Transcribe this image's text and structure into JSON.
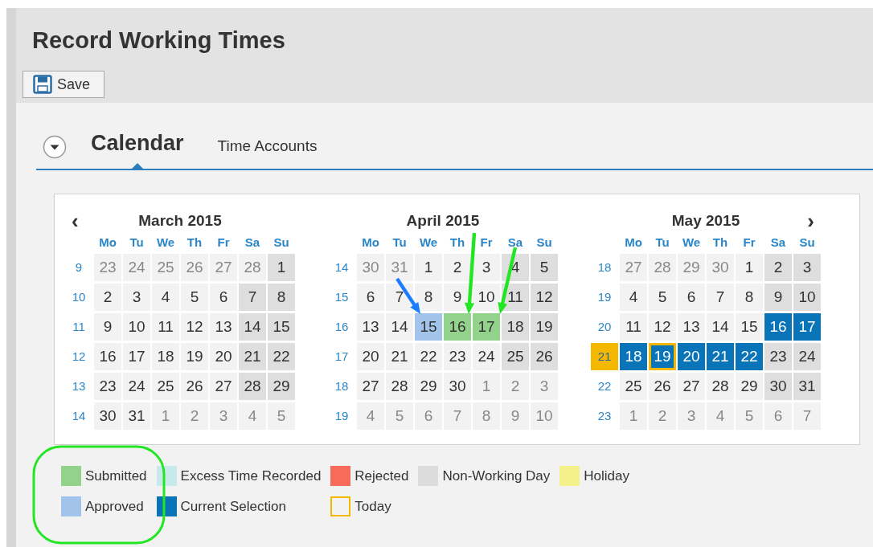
{
  "page": {
    "title": "Record Working Times"
  },
  "toolbar": {
    "save_button": "Save"
  },
  "tabs": [
    {
      "label": "Calendar",
      "selected": true
    },
    {
      "label": "Time Accounts",
      "selected": false
    }
  ],
  "calendar": {
    "prev": "‹",
    "next": "›",
    "months": [
      {
        "title": "March 2015",
        "weekdays": [
          "Mo",
          "Tu",
          "We",
          "Th",
          "Fr",
          "Sa",
          "Su"
        ],
        "weeks": [
          {
            "week": "9",
            "current": false,
            "days": [
              {
                "day": "23",
                "kind": "other",
                "today": false
              },
              {
                "day": "24",
                "kind": "other",
                "today": false
              },
              {
                "day": "25",
                "kind": "other",
                "today": false
              },
              {
                "day": "26",
                "kind": "other",
                "today": false
              },
              {
                "day": "27",
                "kind": "other",
                "today": false
              },
              {
                "day": "28",
                "kind": "other",
                "today": false
              },
              {
                "day": "1",
                "kind": "off",
                "today": false
              }
            ]
          },
          {
            "week": "10",
            "current": false,
            "days": [
              {
                "day": "2",
                "kind": "work",
                "today": false
              },
              {
                "day": "3",
                "kind": "work",
                "today": false
              },
              {
                "day": "4",
                "kind": "work",
                "today": false
              },
              {
                "day": "5",
                "kind": "work",
                "today": false
              },
              {
                "day": "6",
                "kind": "work",
                "today": false
              },
              {
                "day": "7",
                "kind": "off",
                "today": false
              },
              {
                "day": "8",
                "kind": "off",
                "today": false
              }
            ]
          },
          {
            "week": "11",
            "current": false,
            "days": [
              {
                "day": "9",
                "kind": "work",
                "today": false
              },
              {
                "day": "10",
                "kind": "work",
                "today": false
              },
              {
                "day": "11",
                "kind": "work",
                "today": false
              },
              {
                "day": "12",
                "kind": "work",
                "today": false
              },
              {
                "day": "13",
                "kind": "work",
                "today": false
              },
              {
                "day": "14",
                "kind": "off",
                "today": false
              },
              {
                "day": "15",
                "kind": "off",
                "today": false
              }
            ]
          },
          {
            "week": "12",
            "current": false,
            "days": [
              {
                "day": "16",
                "kind": "work",
                "today": false
              },
              {
                "day": "17",
                "kind": "work",
                "today": false
              },
              {
                "day": "18",
                "kind": "work",
                "today": false
              },
              {
                "day": "19",
                "kind": "work",
                "today": false
              },
              {
                "day": "20",
                "kind": "work",
                "today": false
              },
              {
                "day": "21",
                "kind": "off",
                "today": false
              },
              {
                "day": "22",
                "kind": "off",
                "today": false
              }
            ]
          },
          {
            "week": "13",
            "current": false,
            "days": [
              {
                "day": "23",
                "kind": "work",
                "today": false
              },
              {
                "day": "24",
                "kind": "work",
                "today": false
              },
              {
                "day": "25",
                "kind": "work",
                "today": false
              },
              {
                "day": "26",
                "kind": "work",
                "today": false
              },
              {
                "day": "27",
                "kind": "work",
                "today": false
              },
              {
                "day": "28",
                "kind": "off",
                "today": false
              },
              {
                "day": "29",
                "kind": "off",
                "today": false
              }
            ]
          },
          {
            "week": "14",
            "current": false,
            "days": [
              {
                "day": "30",
                "kind": "work",
                "today": false
              },
              {
                "day": "31",
                "kind": "work",
                "today": false
              },
              {
                "day": "1",
                "kind": "other",
                "today": false
              },
              {
                "day": "2",
                "kind": "other",
                "today": false
              },
              {
                "day": "3",
                "kind": "other",
                "today": false
              },
              {
                "day": "4",
                "kind": "other",
                "today": false
              },
              {
                "day": "5",
                "kind": "other",
                "today": false
              }
            ]
          }
        ]
      },
      {
        "title": "April 2015",
        "weekdays": [
          "Mo",
          "Tu",
          "We",
          "Th",
          "Fr",
          "Sa",
          "Su"
        ],
        "weeks": [
          {
            "week": "14",
            "current": false,
            "days": [
              {
                "day": "30",
                "kind": "other",
                "today": false
              },
              {
                "day": "31",
                "kind": "other",
                "today": false
              },
              {
                "day": "1",
                "kind": "work",
                "today": false
              },
              {
                "day": "2",
                "kind": "work",
                "today": false
              },
              {
                "day": "3",
                "kind": "work",
                "today": false
              },
              {
                "day": "4",
                "kind": "off",
                "today": false
              },
              {
                "day": "5",
                "kind": "off",
                "today": false
              }
            ]
          },
          {
            "week": "15",
            "current": false,
            "days": [
              {
                "day": "6",
                "kind": "work",
                "today": false
              },
              {
                "day": "7",
                "kind": "work",
                "today": false
              },
              {
                "day": "8",
                "kind": "work",
                "today": false
              },
              {
                "day": "9",
                "kind": "work",
                "today": false
              },
              {
                "day": "10",
                "kind": "work",
                "today": false
              },
              {
                "day": "11",
                "kind": "off",
                "today": false
              },
              {
                "day": "12",
                "kind": "off",
                "today": false
              }
            ]
          },
          {
            "week": "16",
            "current": false,
            "days": [
              {
                "day": "13",
                "kind": "work",
                "today": false
              },
              {
                "day": "14",
                "kind": "work",
                "today": false
              },
              {
                "day": "15",
                "kind": "approved",
                "today": false
              },
              {
                "day": "16",
                "kind": "submitted",
                "today": false
              },
              {
                "day": "17",
                "kind": "submitted",
                "today": false
              },
              {
                "day": "18",
                "kind": "off",
                "today": false
              },
              {
                "day": "19",
                "kind": "off",
                "today": false
              }
            ]
          },
          {
            "week": "17",
            "current": false,
            "days": [
              {
                "day": "20",
                "kind": "work",
                "today": false
              },
              {
                "day": "21",
                "kind": "work",
                "today": false
              },
              {
                "day": "22",
                "kind": "work",
                "today": false
              },
              {
                "day": "23",
                "kind": "work",
                "today": false
              },
              {
                "day": "24",
                "kind": "work",
                "today": false
              },
              {
                "day": "25",
                "kind": "off",
                "today": false
              },
              {
                "day": "26",
                "kind": "off",
                "today": false
              }
            ]
          },
          {
            "week": "18",
            "current": false,
            "days": [
              {
                "day": "27",
                "kind": "work",
                "today": false
              },
              {
                "day": "28",
                "kind": "work",
                "today": false
              },
              {
                "day": "29",
                "kind": "work",
                "today": false
              },
              {
                "day": "30",
                "kind": "work",
                "today": false
              },
              {
                "day": "1",
                "kind": "other",
                "today": false
              },
              {
                "day": "2",
                "kind": "other",
                "today": false
              },
              {
                "day": "3",
                "kind": "other",
                "today": false
              }
            ]
          },
          {
            "week": "19",
            "current": false,
            "days": [
              {
                "day": "4",
                "kind": "other",
                "today": false
              },
              {
                "day": "5",
                "kind": "other",
                "today": false
              },
              {
                "day": "6",
                "kind": "other",
                "today": false
              },
              {
                "day": "7",
                "kind": "other",
                "today": false
              },
              {
                "day": "8",
                "kind": "other",
                "today": false
              },
              {
                "day": "9",
                "kind": "other",
                "today": false
              },
              {
                "day": "10",
                "kind": "other",
                "today": false
              }
            ]
          }
        ]
      },
      {
        "title": "May 2015",
        "weekdays": [
          "Mo",
          "Tu",
          "We",
          "Th",
          "Fr",
          "Sa",
          "Su"
        ],
        "weeks": [
          {
            "week": "18",
            "current": false,
            "days": [
              {
                "day": "27",
                "kind": "other",
                "today": false
              },
              {
                "day": "28",
                "kind": "other",
                "today": false
              },
              {
                "day": "29",
                "kind": "other",
                "today": false
              },
              {
                "day": "30",
                "kind": "other",
                "today": false
              },
              {
                "day": "1",
                "kind": "work",
                "today": false
              },
              {
                "day": "2",
                "kind": "off",
                "today": false
              },
              {
                "day": "3",
                "kind": "off",
                "today": false
              }
            ]
          },
          {
            "week": "19",
            "current": false,
            "days": [
              {
                "day": "4",
                "kind": "work",
                "today": false
              },
              {
                "day": "5",
                "kind": "work",
                "today": false
              },
              {
                "day": "6",
                "kind": "work",
                "today": false
              },
              {
                "day": "7",
                "kind": "work",
                "today": false
              },
              {
                "day": "8",
                "kind": "work",
                "today": false
              },
              {
                "day": "9",
                "kind": "off",
                "today": false
              },
              {
                "day": "10",
                "kind": "off",
                "today": false
              }
            ]
          },
          {
            "week": "20",
            "current": false,
            "days": [
              {
                "day": "11",
                "kind": "work",
                "today": false
              },
              {
                "day": "12",
                "kind": "work",
                "today": false
              },
              {
                "day": "13",
                "kind": "work",
                "today": false
              },
              {
                "day": "14",
                "kind": "work",
                "today": false
              },
              {
                "day": "15",
                "kind": "work",
                "today": false
              },
              {
                "day": "16",
                "kind": "selected",
                "today": false
              },
              {
                "day": "17",
                "kind": "selected",
                "today": false
              }
            ]
          },
          {
            "week": "21",
            "current": true,
            "days": [
              {
                "day": "18",
                "kind": "selected",
                "today": false
              },
              {
                "day": "19",
                "kind": "selected",
                "today": true
              },
              {
                "day": "20",
                "kind": "selected",
                "today": false
              },
              {
                "day": "21",
                "kind": "selected",
                "today": false
              },
              {
                "day": "22",
                "kind": "selected",
                "today": false
              },
              {
                "day": "23",
                "kind": "off",
                "today": false
              },
              {
                "day": "24",
                "kind": "off",
                "today": false
              }
            ]
          },
          {
            "week": "22",
            "current": false,
            "days": [
              {
                "day": "25",
                "kind": "work",
                "today": false
              },
              {
                "day": "26",
                "kind": "work",
                "today": false
              },
              {
                "day": "27",
                "kind": "work",
                "today": false
              },
              {
                "day": "28",
                "kind": "work",
                "today": false
              },
              {
                "day": "29",
                "kind": "work",
                "today": false
              },
              {
                "day": "30",
                "kind": "off",
                "today": false
              },
              {
                "day": "31",
                "kind": "off",
                "today": false
              }
            ]
          },
          {
            "week": "23",
            "current": false,
            "days": [
              {
                "day": "1",
                "kind": "other",
                "today": false
              },
              {
                "day": "2",
                "kind": "other",
                "today": false
              },
              {
                "day": "3",
                "kind": "other",
                "today": false
              },
              {
                "day": "4",
                "kind": "other",
                "today": false
              },
              {
                "day": "5",
                "kind": "other",
                "today": false
              },
              {
                "day": "6",
                "kind": "other",
                "today": false
              },
              {
                "day": "7",
                "kind": "other",
                "today": false
              }
            ]
          }
        ]
      }
    ]
  },
  "legend": [
    [
      {
        "label": "Submitted",
        "color": "#92d28a",
        "kind": "fill"
      },
      {
        "label": "Excess Time Recorded",
        "color": "#c8e9ec",
        "kind": "fill"
      },
      {
        "label": "Rejected",
        "color": "#f76b5a",
        "kind": "fill"
      },
      {
        "label": "Non-Working Day",
        "color": "#dcdcdc",
        "kind": "fill"
      },
      {
        "label": "Holiday",
        "color": "#f4f08a",
        "kind": "fill"
      }
    ],
    [
      {
        "label": "Approved",
        "color": "#a3c4ea",
        "kind": "fill"
      },
      {
        "label": "Current Selection",
        "color": "#0a74b8",
        "kind": "fill"
      },
      {
        "label": "Today",
        "color": "#f5b800",
        "kind": "outline"
      }
    ]
  ]
}
